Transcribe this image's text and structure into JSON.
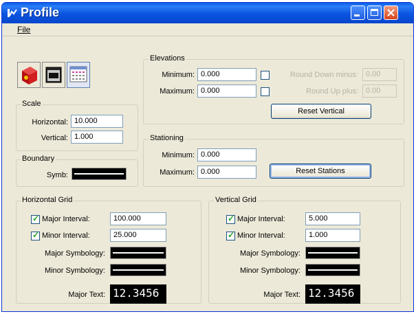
{
  "window": {
    "title": "Profile"
  },
  "menu": {
    "file": "File"
  },
  "toolbar": {
    "icons": [
      "view-3d-icon",
      "window-icon",
      "grid-icon"
    ]
  },
  "scale": {
    "title": "Scale",
    "horizontal_label": "Horizontal:",
    "horizontal_value": "10.000",
    "vertical_label": "Vertical:",
    "vertical_value": "1.000"
  },
  "boundary": {
    "title": "Boundary",
    "symb_label": "Symb:"
  },
  "elevations": {
    "title": "Elevations",
    "minimum_label": "Minimum:",
    "minimum_value": "0.000",
    "maximum_label": "Maximum:",
    "maximum_value": "0.000",
    "round_down_label": "Round Down minus:",
    "round_down_value": "0.00",
    "round_up_label": "Round Up plus:",
    "round_up_value": "0.00",
    "reset_button": "Reset Vertical"
  },
  "stationing": {
    "title": "Stationing",
    "minimum_label": "Minimum:",
    "minimum_value": "0.000",
    "maximum_label": "Maximum:",
    "maximum_value": "0.000",
    "reset_button": "Reset Stations"
  },
  "horizontal_grid": {
    "title": "Horizontal Grid",
    "major_interval_label": "Major Interval:",
    "major_interval_checked": true,
    "major_interval_value": "100.000",
    "minor_interval_label": "Minor Interval:",
    "minor_interval_checked": true,
    "minor_interval_value": "25.000",
    "major_symbology_label": "Major Symbology:",
    "minor_symbology_label": "Minor Symbology:",
    "major_text_label": "Major Text:",
    "major_text_sample": "12.3456"
  },
  "vertical_grid": {
    "title": "Vertical Grid",
    "major_interval_label": "Major Interval:",
    "major_interval_checked": true,
    "major_interval_value": "5.000",
    "minor_interval_label": "Minor Interval:",
    "minor_interval_checked": true,
    "minor_interval_value": "1.000",
    "major_symbology_label": "Major Symbology:",
    "minor_symbology_label": "Minor Symbology:",
    "major_text_label": "Major Text:",
    "major_text_sample": "12.3456"
  }
}
